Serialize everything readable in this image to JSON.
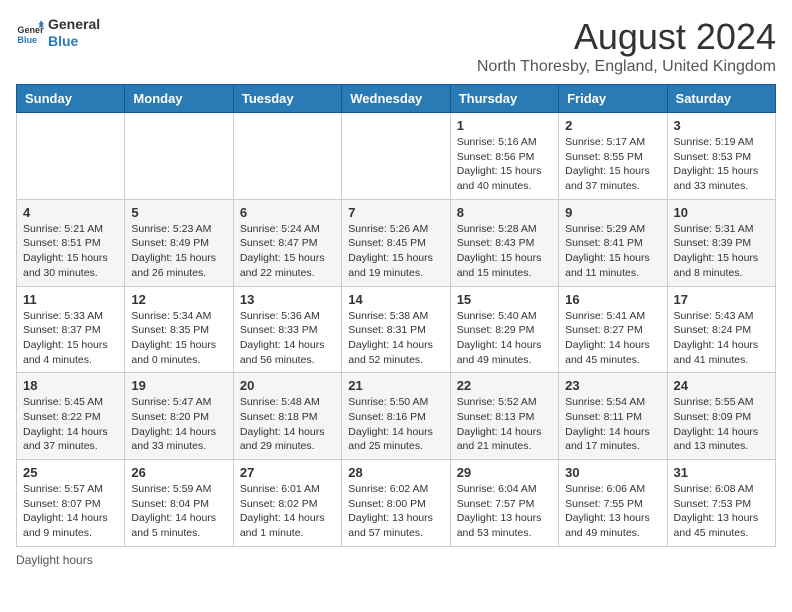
{
  "logo": {
    "line1": "General",
    "line2": "Blue"
  },
  "title": "August 2024",
  "subtitle": "North Thoresby, England, United Kingdom",
  "headers": [
    "Sunday",
    "Monday",
    "Tuesday",
    "Wednesday",
    "Thursday",
    "Friday",
    "Saturday"
  ],
  "weeks": [
    [
      {
        "day": "",
        "info": ""
      },
      {
        "day": "",
        "info": ""
      },
      {
        "day": "",
        "info": ""
      },
      {
        "day": "",
        "info": ""
      },
      {
        "day": "1",
        "info": "Sunrise: 5:16 AM\nSunset: 8:56 PM\nDaylight: 15 hours and 40 minutes."
      },
      {
        "day": "2",
        "info": "Sunrise: 5:17 AM\nSunset: 8:55 PM\nDaylight: 15 hours and 37 minutes."
      },
      {
        "day": "3",
        "info": "Sunrise: 5:19 AM\nSunset: 8:53 PM\nDaylight: 15 hours and 33 minutes."
      }
    ],
    [
      {
        "day": "4",
        "info": "Sunrise: 5:21 AM\nSunset: 8:51 PM\nDaylight: 15 hours and 30 minutes."
      },
      {
        "day": "5",
        "info": "Sunrise: 5:23 AM\nSunset: 8:49 PM\nDaylight: 15 hours and 26 minutes."
      },
      {
        "day": "6",
        "info": "Sunrise: 5:24 AM\nSunset: 8:47 PM\nDaylight: 15 hours and 22 minutes."
      },
      {
        "day": "7",
        "info": "Sunrise: 5:26 AM\nSunset: 8:45 PM\nDaylight: 15 hours and 19 minutes."
      },
      {
        "day": "8",
        "info": "Sunrise: 5:28 AM\nSunset: 8:43 PM\nDaylight: 15 hours and 15 minutes."
      },
      {
        "day": "9",
        "info": "Sunrise: 5:29 AM\nSunset: 8:41 PM\nDaylight: 15 hours and 11 minutes."
      },
      {
        "day": "10",
        "info": "Sunrise: 5:31 AM\nSunset: 8:39 PM\nDaylight: 15 hours and 8 minutes."
      }
    ],
    [
      {
        "day": "11",
        "info": "Sunrise: 5:33 AM\nSunset: 8:37 PM\nDaylight: 15 hours and 4 minutes."
      },
      {
        "day": "12",
        "info": "Sunrise: 5:34 AM\nSunset: 8:35 PM\nDaylight: 15 hours and 0 minutes."
      },
      {
        "day": "13",
        "info": "Sunrise: 5:36 AM\nSunset: 8:33 PM\nDaylight: 14 hours and 56 minutes."
      },
      {
        "day": "14",
        "info": "Sunrise: 5:38 AM\nSunset: 8:31 PM\nDaylight: 14 hours and 52 minutes."
      },
      {
        "day": "15",
        "info": "Sunrise: 5:40 AM\nSunset: 8:29 PM\nDaylight: 14 hours and 49 minutes."
      },
      {
        "day": "16",
        "info": "Sunrise: 5:41 AM\nSunset: 8:27 PM\nDaylight: 14 hours and 45 minutes."
      },
      {
        "day": "17",
        "info": "Sunrise: 5:43 AM\nSunset: 8:24 PM\nDaylight: 14 hours and 41 minutes."
      }
    ],
    [
      {
        "day": "18",
        "info": "Sunrise: 5:45 AM\nSunset: 8:22 PM\nDaylight: 14 hours and 37 minutes."
      },
      {
        "day": "19",
        "info": "Sunrise: 5:47 AM\nSunset: 8:20 PM\nDaylight: 14 hours and 33 minutes."
      },
      {
        "day": "20",
        "info": "Sunrise: 5:48 AM\nSunset: 8:18 PM\nDaylight: 14 hours and 29 minutes."
      },
      {
        "day": "21",
        "info": "Sunrise: 5:50 AM\nSunset: 8:16 PM\nDaylight: 14 hours and 25 minutes."
      },
      {
        "day": "22",
        "info": "Sunrise: 5:52 AM\nSunset: 8:13 PM\nDaylight: 14 hours and 21 minutes."
      },
      {
        "day": "23",
        "info": "Sunrise: 5:54 AM\nSunset: 8:11 PM\nDaylight: 14 hours and 17 minutes."
      },
      {
        "day": "24",
        "info": "Sunrise: 5:55 AM\nSunset: 8:09 PM\nDaylight: 14 hours and 13 minutes."
      }
    ],
    [
      {
        "day": "25",
        "info": "Sunrise: 5:57 AM\nSunset: 8:07 PM\nDaylight: 14 hours and 9 minutes."
      },
      {
        "day": "26",
        "info": "Sunrise: 5:59 AM\nSunset: 8:04 PM\nDaylight: 14 hours and 5 minutes."
      },
      {
        "day": "27",
        "info": "Sunrise: 6:01 AM\nSunset: 8:02 PM\nDaylight: 14 hours and 1 minute."
      },
      {
        "day": "28",
        "info": "Sunrise: 6:02 AM\nSunset: 8:00 PM\nDaylight: 13 hours and 57 minutes."
      },
      {
        "day": "29",
        "info": "Sunrise: 6:04 AM\nSunset: 7:57 PM\nDaylight: 13 hours and 53 minutes."
      },
      {
        "day": "30",
        "info": "Sunrise: 6:06 AM\nSunset: 7:55 PM\nDaylight: 13 hours and 49 minutes."
      },
      {
        "day": "31",
        "info": "Sunrise: 6:08 AM\nSunset: 7:53 PM\nDaylight: 13 hours and 45 minutes."
      }
    ]
  ],
  "footer": "Daylight hours"
}
